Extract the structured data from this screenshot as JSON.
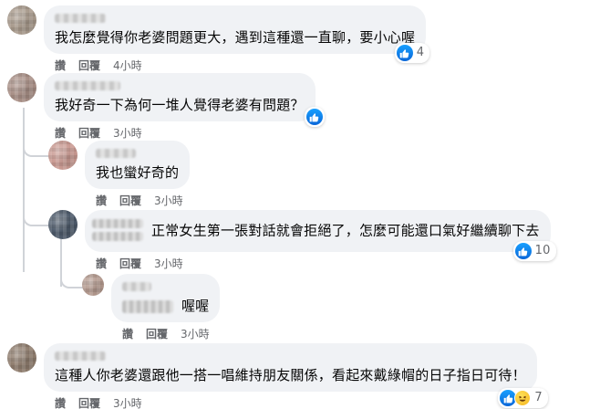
{
  "comments": [
    {
      "text": "我怎麼覺得你老婆問題更大，遇到這種還一直聊，要小心喔",
      "actions": {
        "like": "讚",
        "reply": "回覆",
        "time": "4小時"
      },
      "reaction_count": "4"
    },
    {
      "text": "我好奇一下為何一堆人覺得老婆有問題？",
      "actions": {
        "like": "讚",
        "reply": "回覆",
        "time": "3小時"
      },
      "reaction_count": ""
    },
    {
      "text": "我也蠻好奇的",
      "actions": {
        "like": "讚",
        "reply": "回覆",
        "time": "3小時"
      }
    },
    {
      "text": "正常女生第一張對話就會拒絕了，怎麼可能還口氣好繼續聊下去",
      "actions": {
        "like": "讚",
        "reply": "回覆",
        "time": "3小時"
      },
      "reaction_count": "10"
    },
    {
      "text": "喔喔",
      "actions": {
        "like": "讚",
        "reply": "回覆",
        "time": "3小時"
      }
    },
    {
      "text": "這種人你老婆還跟他一搭一唱維持朋友關係，看起來戴綠帽的日子指日可待！",
      "actions": {
        "like": "讚",
        "reply": "回覆",
        "time": "3小時"
      },
      "reaction_count": "7"
    }
  ],
  "colors": {
    "bubble": "#f0f2f5",
    "meta": "#65676b",
    "like_blue": "#0a66d8",
    "haha_yellow": "#f5b41d"
  },
  "icons": [
    "like-icon",
    "haha-icon"
  ]
}
